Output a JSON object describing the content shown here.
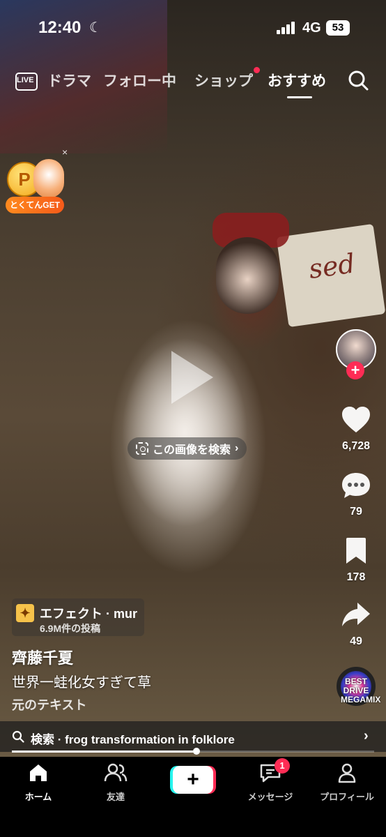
{
  "status_bar": {
    "time": "12:40",
    "network": "4G",
    "battery": "53"
  },
  "top_nav": {
    "live_label": "LIVE",
    "tabs": [
      {
        "label": "ドラマ"
      },
      {
        "label": "フォロー中"
      },
      {
        "label": "ショップ"
      },
      {
        "label": "おすすめ"
      }
    ],
    "active_tab": "おすすめ"
  },
  "promo": {
    "coin_letter": "P",
    "label": "とくてんGET",
    "close": "×"
  },
  "video": {
    "sign_text": "sed"
  },
  "image_search": {
    "label": "この画像を検索",
    "chevron": "›"
  },
  "actions": {
    "likes": "6,728",
    "comments": "79",
    "saves": "178",
    "shares": "49"
  },
  "music": {
    "disc_text": "BEST DRIVE MEGAMIX"
  },
  "effect": {
    "title": "エフェクト · mur",
    "posts": "6.9M件の投稿"
  },
  "post": {
    "author": "齊藤千夏",
    "caption": "世界一蛙化女すぎて草",
    "original_text": "元のテキスト"
  },
  "search_bar": {
    "prefix": "検索",
    "query": " · frog transformation in folklore"
  },
  "playback": {
    "progress": 0.51
  },
  "bottom_nav": {
    "home": "ホーム",
    "friends": "友達",
    "create": "+",
    "inbox": "メッセージ",
    "inbox_badge": "1",
    "profile": "プロフィール"
  },
  "colors": {
    "accent": "#fe2c55",
    "accent_cyan": "#25f4ee"
  }
}
